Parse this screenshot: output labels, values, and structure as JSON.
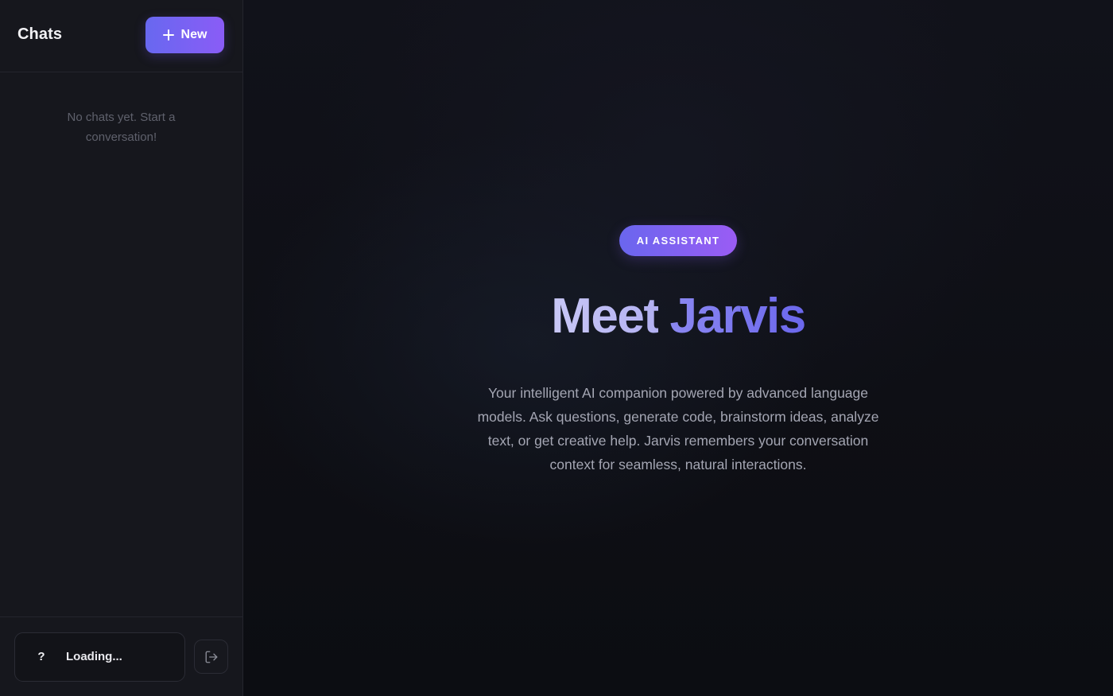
{
  "sidebar": {
    "title": "Chats",
    "new_button_label": "New",
    "empty_state": "No chats yet. Start a conversation!",
    "user": {
      "avatar_initial": "?",
      "name": "Loading..."
    },
    "logout_icon": "logout-icon"
  },
  "main": {
    "badge": "AI ASSISTANT",
    "headline_part1": "Meet",
    "headline_part2": "Jarvis",
    "description": "Your intelligent AI companion powered by advanced language models. Ask questions, generate code, brainstorm ideas, analyze text, or get creative help. Jarvis remembers your conversation context for seamless, natural interactions."
  },
  "colors": {
    "accent_start": "#6868f0",
    "accent_end": "#8a5cf6",
    "background": "#0d0e13",
    "sidebar_background": "#16171d"
  }
}
